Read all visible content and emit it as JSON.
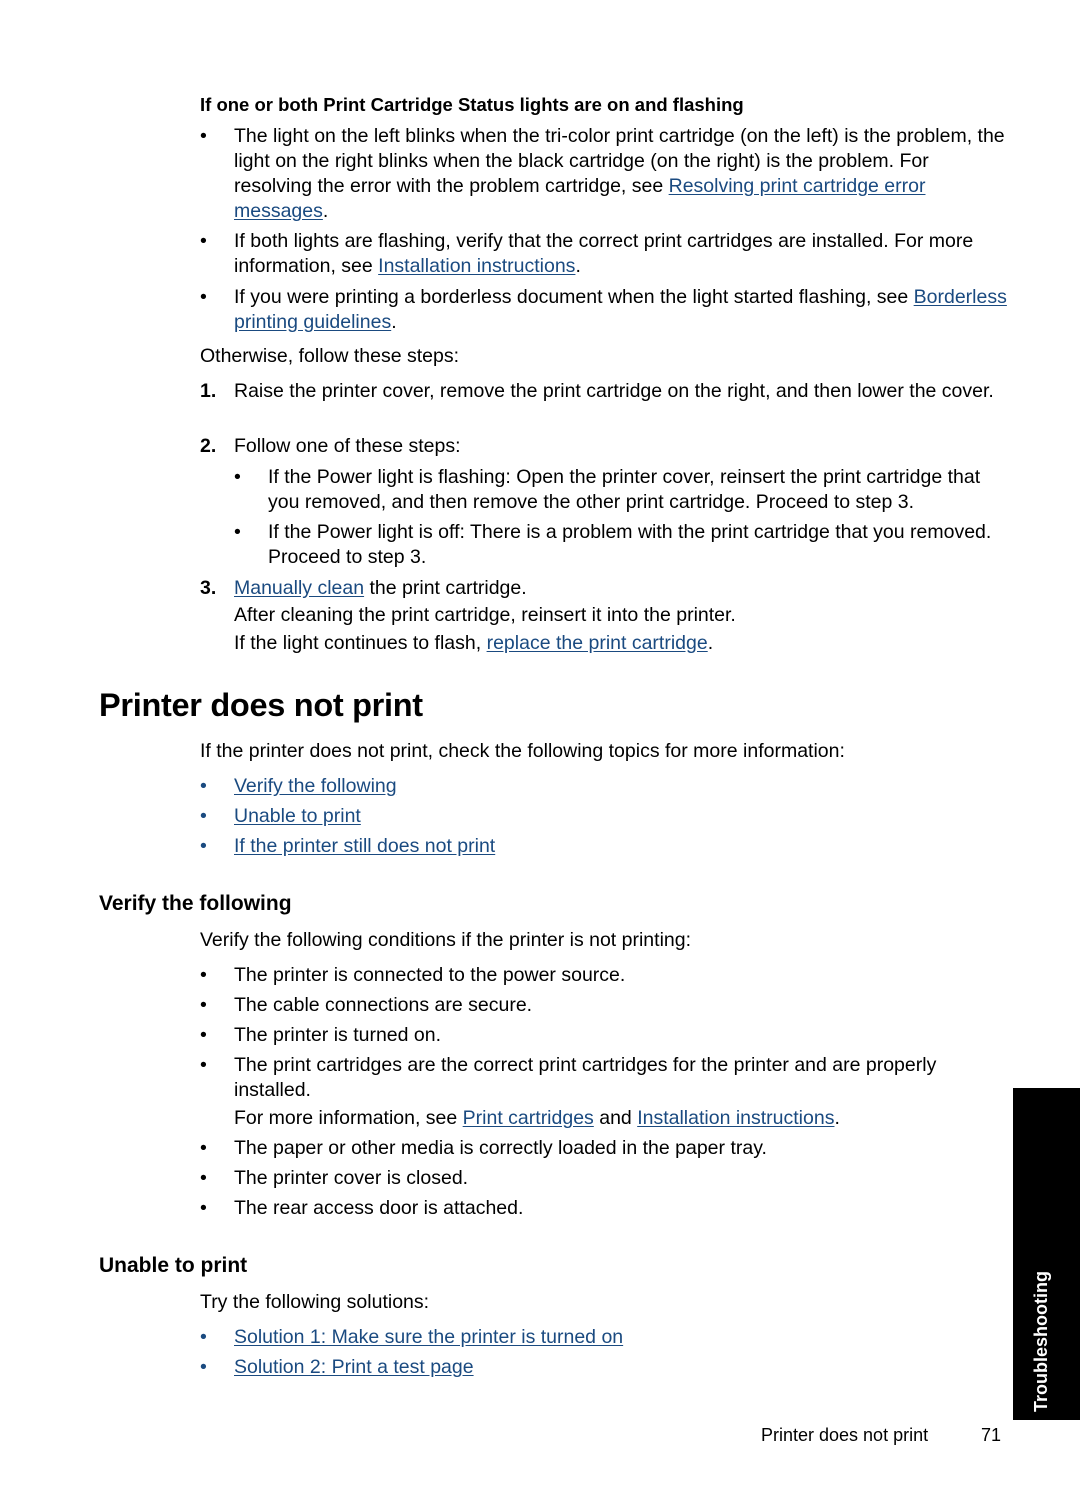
{
  "section_top": {
    "heading": "If one or both Print Cartridge Status lights are on and flashing",
    "bullets": [
      {
        "pre": "The light on the left blinks when the tri-color print cartridge (on the left) is the problem, the light on the right blinks when the black cartridge (on the right) is the problem. For resolving the error with the problem cartridge, see ",
        "link": "Resolving print cartridge error messages",
        "post": "."
      },
      {
        "pre": "If both lights are flashing, verify that the correct print cartridges are installed. For more information, see ",
        "link": "Installation instructions",
        "post": "."
      },
      {
        "pre": "If you were printing a borderless document when the light started flashing, see ",
        "link": "Borderless printing guidelines",
        "post": "."
      }
    ],
    "otherwise": "Otherwise, follow these steps:",
    "steps": [
      {
        "num": "1.",
        "text": "Raise the printer cover, remove the print cartridge on the right, and then lower the cover."
      },
      {
        "num": "2.",
        "text": "Follow one of these steps:",
        "sub": [
          "If the Power light is flashing: Open the printer cover, reinsert the print cartridge that you removed, and then remove the other print cartridge. Proceed to step 3.",
          "If the Power light is off: There is a problem with the print cartridge that you removed. Proceed to step 3."
        ]
      },
      {
        "num": "3.",
        "link": "Manually clean",
        "post": " the print cartridge.",
        "line2": "After cleaning the print cartridge, reinsert it into the printer.",
        "line3_pre": "If the light continues to flash, ",
        "line3_link": "replace the print cartridge",
        "line3_post": "."
      }
    ]
  },
  "printer_does_not_print": {
    "title": "Printer does not print",
    "intro": "If the printer does not print, check the following topics for more information:",
    "topics": [
      "Verify the following",
      "Unable to print",
      "If the printer still does not print"
    ]
  },
  "verify": {
    "title": "Verify the following",
    "intro": "Verify the following conditions if the printer is not printing:",
    "items": [
      "The printer is connected to the power source.",
      "The cable connections are secure.",
      "The printer is turned on.",
      "The print cartridges are the correct print cartridges for the printer and are properly installed.",
      "The paper or other media is correctly loaded in the paper tray.",
      "The printer cover is closed.",
      "The rear access door is attached."
    ],
    "more_info_pre": "For more information, see ",
    "more_info_link1": "Print cartridges",
    "more_info_mid": " and ",
    "more_info_link2": "Installation instructions",
    "more_info_post": "."
  },
  "unable": {
    "title": "Unable to print",
    "intro": "Try the following solutions:",
    "solutions": [
      "Solution 1: Make sure the printer is turned on",
      "Solution 2: Print a test page"
    ]
  },
  "side_tab": {
    "label": "Troubleshooting"
  },
  "footer": {
    "title": "Printer does not print",
    "page": "71"
  },
  "colors": {
    "link": "#1a4a80",
    "text": "#000000",
    "tab": "#000000"
  }
}
